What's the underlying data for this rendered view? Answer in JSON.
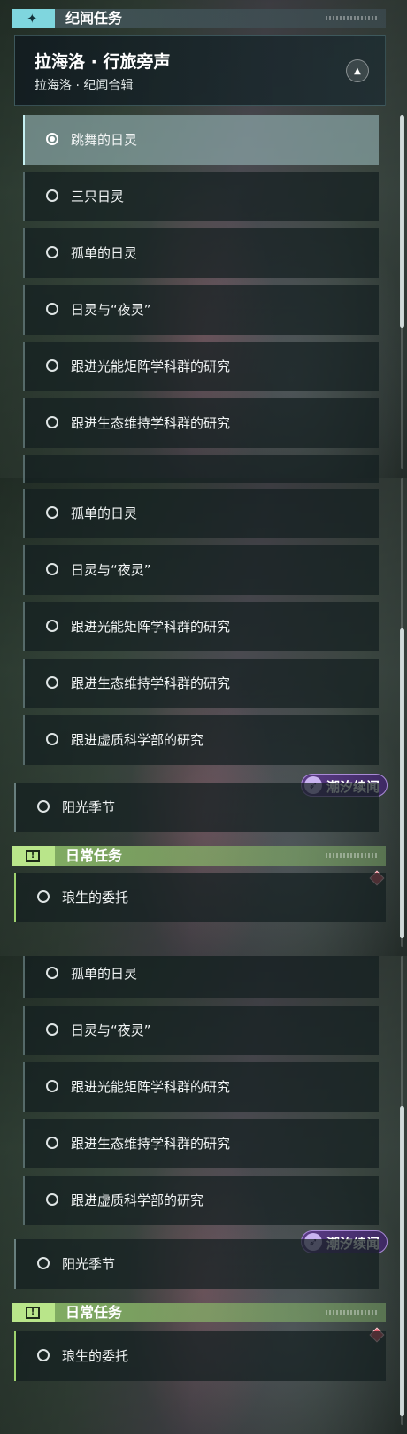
{
  "panel1": {
    "header": {
      "title": "纪闻任务",
      "icon": "sparkle-icon"
    },
    "series": {
      "name": "拉海洛 · 行旅旁声",
      "sub": "拉海洛 · 纪闻合辑",
      "collapse_icon": "collapse-triangle-icon"
    },
    "quests": [
      {
        "label": "跳舞的日灵",
        "selected": true
      },
      {
        "label": "三只日灵",
        "selected": false
      },
      {
        "label": "孤单的日灵",
        "selected": false
      },
      {
        "label": "日灵与“夜灵”",
        "selected": false
      },
      {
        "label": "跟进光能矩阵学科群的研究",
        "selected": false
      },
      {
        "label": "跟进生态维持学科群的研究",
        "selected": false
      }
    ]
  },
  "panel2": {
    "quests": [
      {
        "label": "孤单的日灵"
      },
      {
        "label": "日灵与“夜灵”"
      },
      {
        "label": "跟进光能矩阵学科群的研究"
      },
      {
        "label": "跟进生态维持学科群的研究"
      },
      {
        "label": "跟进虚质科学部的研究"
      }
    ],
    "badge": {
      "text": "潮汐续闻"
    },
    "main_quest": {
      "label": "阳光季节"
    },
    "daily_header": {
      "title": "日常任务",
      "icon": "alert-icon"
    },
    "daily_quest": {
      "label": "琅生的委托"
    }
  },
  "panel3": {
    "quests": [
      {
        "label": "孤单的日灵"
      },
      {
        "label": "日灵与“夜灵”"
      },
      {
        "label": "跟进光能矩阵学科群的研究"
      },
      {
        "label": "跟进生态维持学科群的研究"
      },
      {
        "label": "跟进虚质科学部的研究"
      }
    ],
    "badge": {
      "text": "潮汐续闻"
    },
    "main_quest": {
      "label": "阳光季节"
    },
    "daily_header": {
      "title": "日常任务",
      "icon": "alert-icon"
    },
    "daily_quest": {
      "label": "琅生的委托"
    }
  },
  "colors": {
    "accent_teal": "#7fd6de",
    "accent_green": "#b9e58a",
    "badge_purple": "#5b3b86",
    "alert_red": "#e05a6a"
  }
}
